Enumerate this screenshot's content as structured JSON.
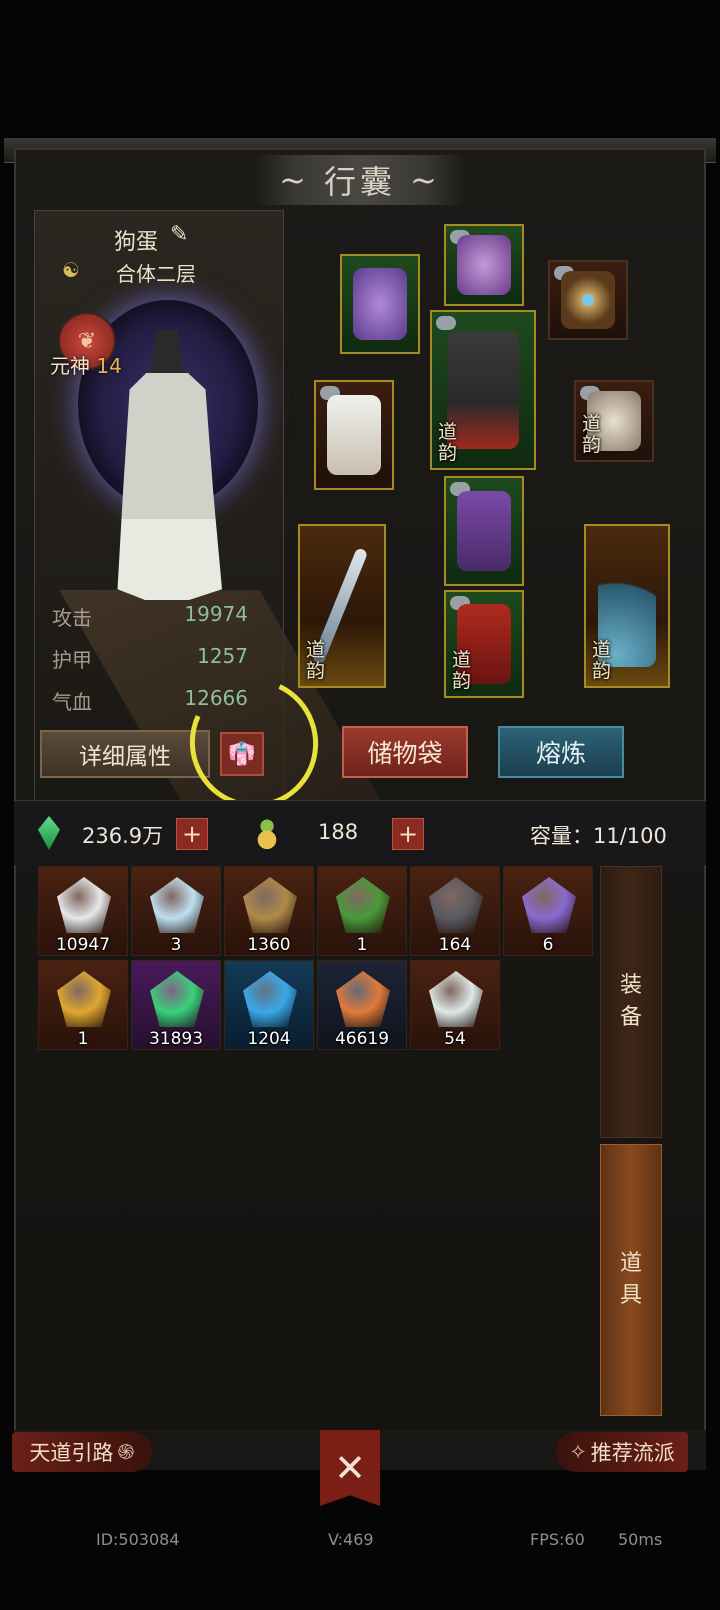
{
  "header": {
    "title": "行囊"
  },
  "character": {
    "name": "狗蛋",
    "realm": "合体二层",
    "soul_label": "元神",
    "soul_level": "14",
    "stats": [
      {
        "label": "攻击",
        "value": "19974"
      },
      {
        "label": "护甲",
        "value": "1257"
      },
      {
        "label": "气血",
        "value": "12666"
      }
    ]
  },
  "equipment": {
    "daoyun_label": "道\n韵",
    "slots": [
      "pendant",
      "hairpin",
      "necklace",
      "boots-armor",
      "robe",
      "ring",
      "trousers",
      "sword",
      "shoes",
      "fan"
    ]
  },
  "buttons": {
    "detail": "详细属性",
    "armor_icon": "robe-icon",
    "storage": "储物袋",
    "smelt": "熔炼"
  },
  "currency": {
    "jade": "236.9万",
    "gourd": "188",
    "plus": "+",
    "capacity": "容量：11/100"
  },
  "inventory": [
    {
      "qty": "10947",
      "icon": "white-crystal-icon",
      "color": "#e8e8ea"
    },
    {
      "qty": "3",
      "icon": "ice-shards-icon",
      "color": "#bfe0f0"
    },
    {
      "qty": "1360",
      "icon": "ore-pile-icon",
      "color": "#b08a4a"
    },
    {
      "qty": "1",
      "icon": "colored-orb-icon",
      "color": "#4a9a3a"
    },
    {
      "qty": "164",
      "icon": "dark-stone-icon",
      "color": "#5a5a60"
    },
    {
      "qty": "6",
      "icon": "purple-crystal-icon",
      "color": "#8a6ad0"
    },
    {
      "qty": "1",
      "icon": "gold-nugget-icon",
      "color": "#e0a830"
    },
    {
      "qty": "31893",
      "icon": "green-crystal-icon",
      "color": "#3ad07a"
    },
    {
      "qty": "1204",
      "icon": "blue-crystal-icon",
      "color": "#3aa8e8"
    },
    {
      "qty": "46619",
      "icon": "gem-fragments-icon",
      "color": "#e07a3a"
    },
    {
      "qty": "54",
      "icon": "taiji-icon",
      "color": "#dfe8e8"
    }
  ],
  "tabs": {
    "equip": [
      "装",
      "备"
    ],
    "items": [
      "道",
      "具"
    ]
  },
  "bottom_nav": {
    "left": "天道引路",
    "right": "推荐流派",
    "close": "✕"
  },
  "footer": {
    "id": "ID:503084",
    "version": "V:469",
    "fps": "FPS:60",
    "latency": "50ms"
  }
}
